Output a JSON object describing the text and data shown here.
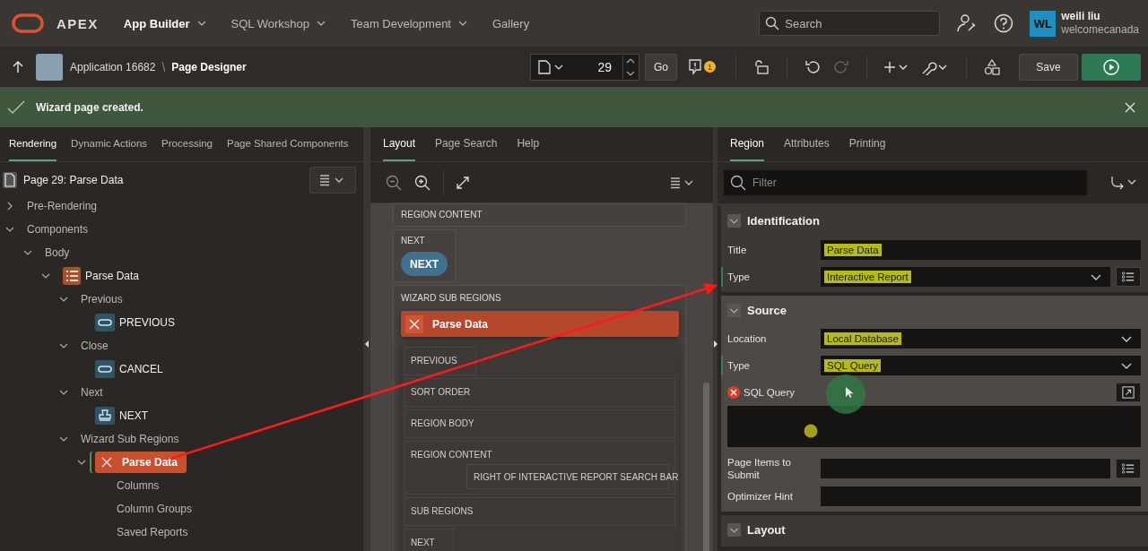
{
  "header": {
    "product": "APEX",
    "nav": [
      {
        "label": "App Builder",
        "selected": true,
        "has_menu": true
      },
      {
        "label": "SQL Workshop",
        "selected": false,
        "has_menu": true
      },
      {
        "label": "Team Development",
        "selected": false,
        "has_menu": true
      },
      {
        "label": "Gallery",
        "selected": false,
        "has_menu": false
      }
    ],
    "search": {
      "placeholder": "Search"
    },
    "user": {
      "initials": "WL",
      "name": "weili liu",
      "workspace": "welcomecanada"
    }
  },
  "toolbar": {
    "breadcrumb": [
      "Application 16682",
      "Page Designer"
    ],
    "breadcrumb_separator": "\\",
    "page_number": "29",
    "go": "Go",
    "issues_count": "1",
    "redo_disabled": true,
    "save": "Save"
  },
  "message": {
    "text": "Wizard page created."
  },
  "left": {
    "tabs": [
      {
        "label": "Rendering",
        "selected": true
      },
      {
        "label": "Dynamic Actions",
        "selected": false
      },
      {
        "label": "Processing",
        "selected": false
      },
      {
        "label": "Page Shared Components",
        "selected": false
      }
    ],
    "page_title": "Page 29: Parse Data",
    "tree": [
      {
        "label": "Pre-Rendering",
        "expanded": false,
        "selected": false
      },
      {
        "label": "Components",
        "expanded": true,
        "selected": false,
        "children": [
          {
            "label": "Body",
            "expanded": true,
            "selected": false,
            "children": [
              {
                "label": "Parse Data",
                "kind": "region",
                "expanded": true,
                "selected": false,
                "children": [
                  {
                    "label": "Previous",
                    "expanded": true,
                    "selected": false,
                    "children": [
                      {
                        "label": "PREVIOUS",
                        "kind": "button",
                        "selected": false
                      }
                    ]
                  },
                  {
                    "label": "Close",
                    "expanded": true,
                    "selected": false,
                    "children": [
                      {
                        "label": "CANCEL",
                        "kind": "button",
                        "selected": false
                      }
                    ]
                  },
                  {
                    "label": "Next",
                    "expanded": true,
                    "selected": false,
                    "children": [
                      {
                        "label": "NEXT",
                        "kind": "submit",
                        "selected": false
                      }
                    ]
                  },
                  {
                    "label": "Wizard Sub Regions",
                    "expanded": true,
                    "selected": false,
                    "children": [
                      {
                        "label": "Parse Data",
                        "kind": "report",
                        "expanded": true,
                        "selected": true,
                        "children": [
                          {
                            "label": "Columns",
                            "selected": false
                          },
                          {
                            "label": "Column Groups",
                            "selected": false
                          },
                          {
                            "label": "Saved Reports",
                            "selected": false
                          }
                        ]
                      }
                    ]
                  }
                ]
              }
            ]
          }
        ]
      }
    ]
  },
  "middle": {
    "tabs": [
      {
        "label": "Layout",
        "selected": true
      },
      {
        "label": "Page Search",
        "selected": false
      },
      {
        "label": "Help",
        "selected": false
      }
    ],
    "canvas": {
      "top_slot": "REGION CONTENT",
      "next_slot": {
        "label": "NEXT",
        "button": "NEXT"
      },
      "wizard_slot": {
        "label": "WIZARD SUB REGIONS",
        "region_title": "Parse Data",
        "slots": [
          {
            "label": "PREVIOUS",
            "kind": "small"
          },
          {
            "label": "SORT ORDER",
            "kind": "full"
          },
          {
            "label": "REGION BODY",
            "kind": "full"
          },
          {
            "label": "REGION CONTENT",
            "kind": "full",
            "child": "RIGHT OF INTERACTIVE REPORT SEARCH BAR"
          },
          {
            "label": "SUB REGIONS",
            "kind": "full"
          },
          {
            "label": "NEXT",
            "kind": "small"
          }
        ]
      }
    }
  },
  "right": {
    "tabs": [
      {
        "label": "Region",
        "selected": true
      },
      {
        "label": "Attributes",
        "selected": false
      },
      {
        "label": "Printing",
        "selected": false
      }
    ],
    "filter": {
      "placeholder": "Filter"
    },
    "sections": [
      {
        "title": "Identification",
        "expanded": true,
        "rows": [
          {
            "label": "Title",
            "kind": "text",
            "value": "Parse  Data",
            "highlighted": true,
            "modified": false
          },
          {
            "label": "Type",
            "kind": "select",
            "value": "Interactive Report",
            "highlighted": true,
            "modified": true,
            "list_button": true
          }
        ]
      },
      {
        "title": "Source",
        "expanded": true,
        "rows": [
          {
            "label": "Location",
            "kind": "select",
            "value": "Local Database",
            "highlighted": true,
            "modified": false
          },
          {
            "label": "Type",
            "kind": "select",
            "value": "SQL Query",
            "highlighted": true,
            "modified": true
          },
          {
            "label": "SQL Query",
            "kind": "code",
            "error": true,
            "modified": false
          },
          {
            "label": "Page Items to Submit",
            "kind": "text",
            "modified": false,
            "list_button": true
          },
          {
            "label": "Optimizer Hint",
            "kind": "text",
            "modified": false
          }
        ]
      },
      {
        "title": "Layout",
        "expanded": true
      }
    ]
  }
}
